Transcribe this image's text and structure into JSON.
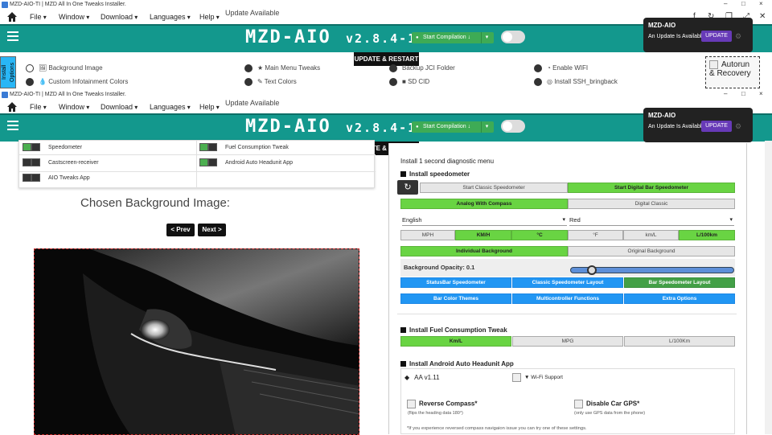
{
  "window": {
    "title": "MZD-AIO-TI | MZD All In One Tweaks Installer.",
    "controls": [
      "–",
      "□",
      "×"
    ]
  },
  "menu": {
    "items": [
      "File",
      "Window",
      "Download",
      "Languages",
      "Help"
    ],
    "update_available": "Update Available"
  },
  "banner": {
    "logo": "MZD-AIO",
    "version": "v2.8.4-1",
    "start_compilation": "Start Compilation",
    "update_restart": "UPDATE & RESTART"
  },
  "notification": {
    "title": "MZD-AIO",
    "message": "An Update Is Available:",
    "button": "UPDATE"
  },
  "options": {
    "col1": [
      "Background Image",
      "Custom Infotainment Colors"
    ],
    "col2": [
      "Main Menu Tweaks",
      "Text Colors"
    ],
    "col3": [
      "Backup JCI Folder",
      "SD CID"
    ],
    "col4": [
      "Enable WIFI",
      "Install SSH_bringback"
    ],
    "install_tab": "Install Options",
    "autorun": "Autorun & Recovery"
  },
  "tweaks": {
    "left": [
      "Speedometer",
      "Castscreen-receiver",
      "AIO Tweaks App"
    ],
    "right": [
      "Fuel Consumption Tweak",
      "Android Auto Headunit App"
    ]
  },
  "background": {
    "chosen_label": "Chosen Background Image:",
    "prev": "< Prev",
    "next": "Next >"
  },
  "panel": {
    "diag": "Install 1 second diagnostic menu",
    "speedo_title": "Install speedometer",
    "start_classic": "Start Classic Speedometer",
    "start_digital": "Start Digital Bar Speedometer",
    "analog_compass": "Analog With Compass",
    "digital_classic": "Digital Classic",
    "lang_select": "English",
    "color_select": "Red",
    "units": [
      "MPH",
      "KM/H",
      "°C",
      "°F",
      "km/L",
      "L/100km"
    ],
    "individual_bg": "Individual Background",
    "original_bg": "Original Background",
    "bg_opacity": "Background Opacity: 0.1",
    "statusbar": "StatusBar Speedometer",
    "classic_layout": "Classic Speedometer Layout",
    "bar_layout": "Bar Speedometer Layout",
    "bar_color": "Bar Color Themes",
    "multicontroller": "Multicontroller Functions",
    "extra": "Extra Options",
    "fuel_title": "Install Fuel Consumption Tweak",
    "fuel_opts": [
      "Km/L",
      "MPG",
      "L/100Km"
    ],
    "aa_title": "Install Android Auto Headunit App",
    "aa_version": "AA v1.11",
    "wifi_support": "Wi-Fi Support",
    "reverse_compass": "Reverse Compass*",
    "reverse_compass_note": "(flips the heading data 180°)",
    "disable_gps": "Disable Car GPS*",
    "disable_gps_note": "(only use GPS data from the phone)",
    "footnote": "*If you experience reversed compass navigaion issue you can try one of these settings."
  }
}
